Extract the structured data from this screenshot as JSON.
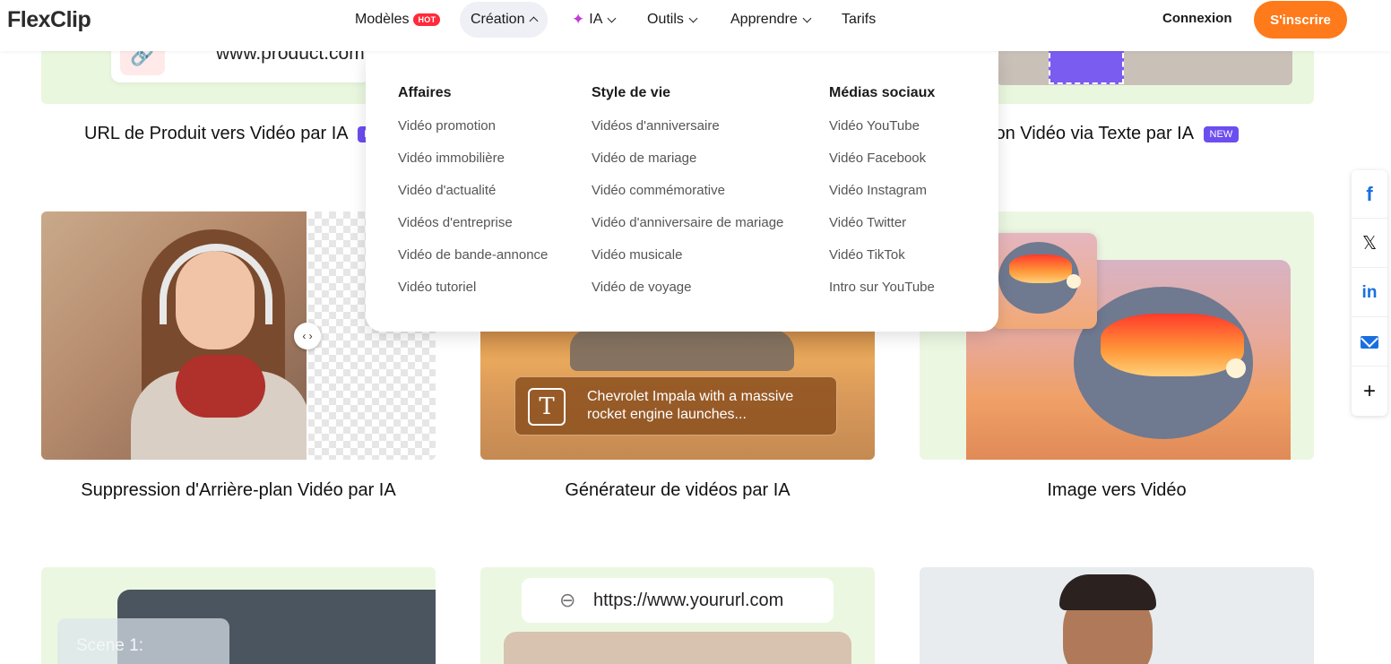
{
  "brand": {
    "logo_text": "FlexClip",
    "accent_color": "#ff7a1a"
  },
  "nav": {
    "items": [
      {
        "label": "Modèles",
        "badge": "HOT"
      },
      {
        "label": "Création"
      },
      {
        "label": "IA"
      },
      {
        "label": "Outils"
      },
      {
        "label": "Apprendre"
      },
      {
        "label": "Tarifs"
      }
    ],
    "login": "Connexion",
    "signup": "S'inscrire"
  },
  "dropdown": {
    "columns": [
      {
        "title": "Affaires",
        "items": [
          "Vidéo promotion",
          "Vidéo immobilière",
          "Vidéo d'actualité",
          "Vidéos d'entreprise",
          "Vidéo de bande-annonce",
          "Vidéo tutoriel"
        ]
      },
      {
        "title": "Style de vie",
        "items": [
          "Vidéos d'anniversaire",
          "Vidéo de mariage",
          "Vidéo commémorative",
          "Vidéo d'anniversaire de mariage",
          "Vidéo musicale",
          "Vidéo de voyage"
        ]
      },
      {
        "title": "Médias sociaux",
        "items": [
          "Vidéo YouTube",
          "Vidéo Facebook",
          "Vidéo Instagram",
          "Vidéo Twitter",
          "Vidéo TikTok",
          "Intro sur YouTube"
        ]
      }
    ]
  },
  "cards": {
    "url_to_video": {
      "title": "URL de Produit vers Vidéo par IA",
      "url_text": "www.product.com",
      "badge": "N"
    },
    "edit_via_text": {
      "title": "ition Vidéo via Texte par IA",
      "badge": "NEW"
    },
    "bg_removal": {
      "title": "Suppression d'Arrière-plan Vidéo par IA",
      "handle": "‹ ›"
    },
    "ai_generator": {
      "title": "Générateur de vidéos par IA",
      "prompt": "Chevrolet Impala with a massive rocket engine launches...",
      "prompt_icon": "T"
    },
    "image_to_video": {
      "title": "Image vers Vidéo"
    },
    "scene": {
      "label": "Scene 1:"
    },
    "your_url": {
      "url_text": "https://www.yoururl.com"
    }
  },
  "share": [
    "facebook-icon",
    "x-icon",
    "linkedin-icon",
    "mail-icon",
    "plus-icon"
  ]
}
